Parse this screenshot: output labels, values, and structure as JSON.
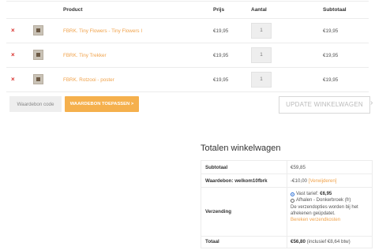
{
  "cart": {
    "headers": {
      "product": "Product",
      "price": "Prijs",
      "quantity": "Aantal",
      "subtotal": "Subtotaal"
    },
    "items": [
      {
        "remove": "×",
        "name": "FBRK. Tiny Flowers - Tiny Flowers I",
        "price": "€19,95",
        "qty": "1",
        "subtotal": "€19,95"
      },
      {
        "remove": "×",
        "name": "FBRK. Tiny Trekker",
        "price": "€19,95",
        "qty": "1",
        "subtotal": "€19,95"
      },
      {
        "remove": "×",
        "name": "FBRK. Rotzooi - poster",
        "price": "€19,95",
        "qty": "1",
        "subtotal": "€19,95"
      }
    ]
  },
  "coupon": {
    "placeholder": "Waardebon code",
    "apply_label": "WAARDEBON TOEPASSEN >"
  },
  "update_label": "UPDATE WINKELWAGEN",
  "update_chevron": "›",
  "totals": {
    "title": "Totalen winkelwagen",
    "subtotal_label": "Subtotaal",
    "subtotal_value": "€59,85",
    "coupon_label": "Waardebon: welkom10fbrk",
    "coupon_value": "-€10,00",
    "coupon_remove": "[Verwijderen]",
    "shipping_label": "Verzending",
    "shipping_option1_prefix": "Vast tarief:",
    "shipping_option1_price": "€6,95",
    "shipping_option2": "Afhalen - Donkerbroek (fr)",
    "shipping_note": "De verzendopties worden bij het afrekenen geüpdatet.",
    "shipping_calc": "Bereken verzendkosten",
    "total_label": "Totaal",
    "total_value": "€56,80",
    "total_tax": "(inclusief €8,64 btw)"
  }
}
